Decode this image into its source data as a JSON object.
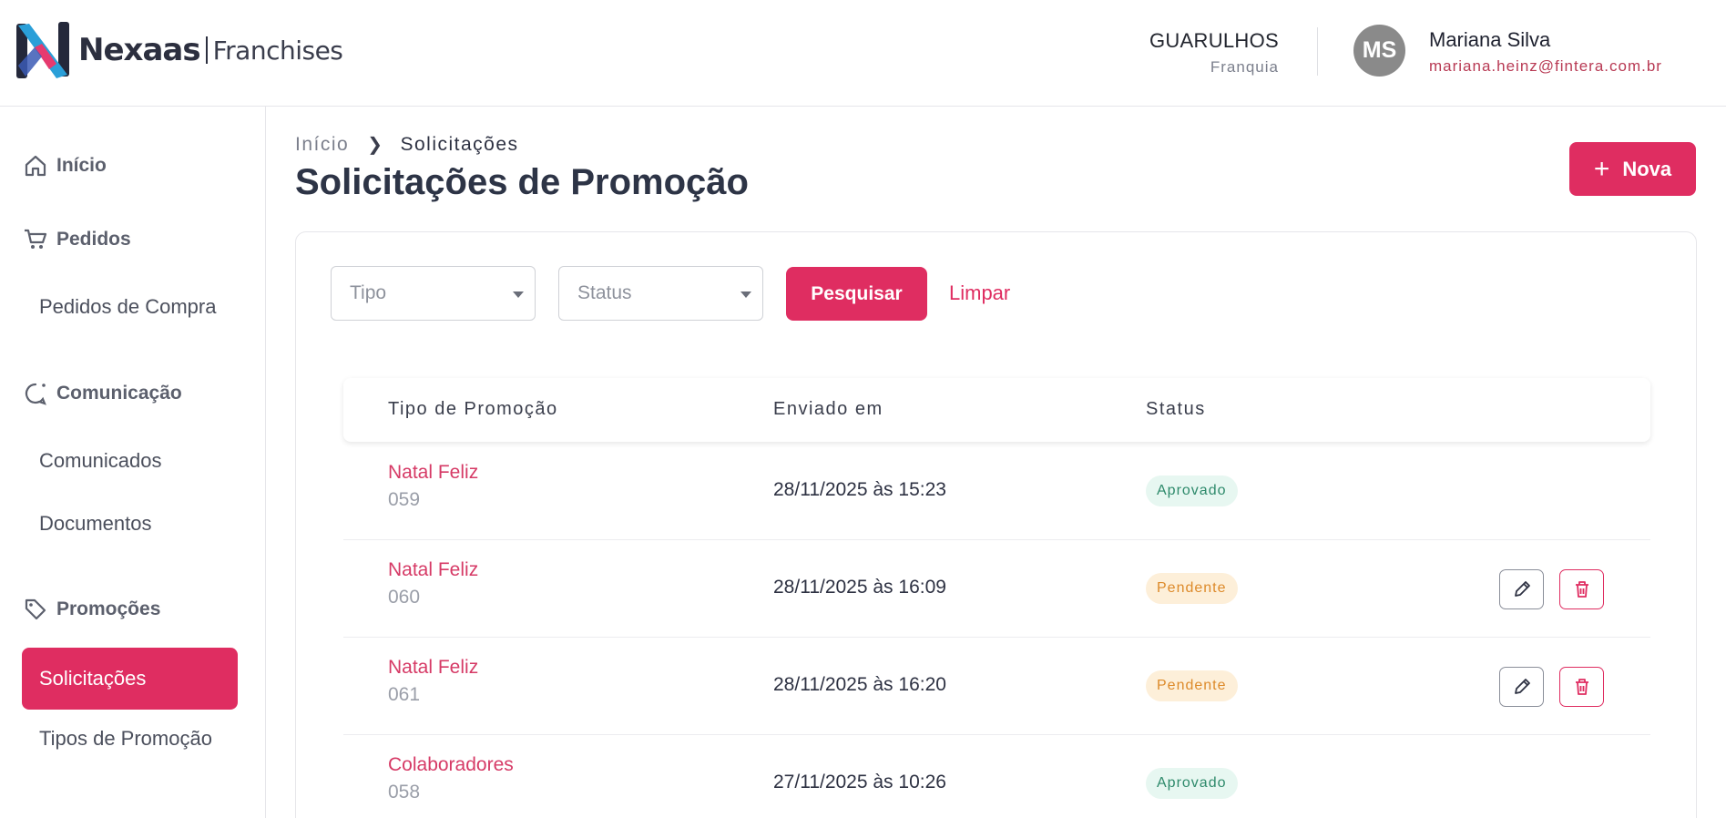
{
  "header": {
    "brand": "Nexaas",
    "brand_sub": "Franchises",
    "branch_name": "GUARULHOS",
    "branch_type": "Franquia",
    "avatar_initials": "MS",
    "user_name": "Mariana Silva",
    "user_email": "mariana.heinz@fintera.com.br"
  },
  "sidebar": {
    "home": "Início",
    "orders": "Pedidos",
    "purchase_orders": "Pedidos de Compra",
    "communication": "Comunicação",
    "announcements": "Comunicados",
    "documents": "Documentos",
    "promotions": "Promoções",
    "requests": "Solicitações",
    "promo_types": "Tipos de Promoção"
  },
  "breadcrumb": {
    "home": "Início",
    "current": "Solicitações"
  },
  "page": {
    "title": "Solicitações de Promoção",
    "new_label": "Nova"
  },
  "filters": {
    "type_placeholder": "Tipo",
    "status_placeholder": "Status",
    "search_label": "Pesquisar",
    "clear_label": "Limpar"
  },
  "table": {
    "columns": [
      "Tipo de Promoção",
      "Enviado em",
      "Status"
    ],
    "rows": [
      {
        "type": "Natal Feliz",
        "number": "059",
        "sent": "28/11/2025 às 15:23",
        "status": "Aprovado"
      },
      {
        "type": "Natal Feliz",
        "number": "060",
        "sent": "28/11/2025 às 16:09",
        "status": "Pendente"
      },
      {
        "type": "Natal Feliz",
        "number": "061",
        "sent": "28/11/2025 às 16:20",
        "status": "Pendente"
      },
      {
        "type": "Colaboradores",
        "number": "058",
        "sent": "27/11/2025 às 10:26",
        "status": "Aprovado"
      }
    ]
  },
  "colors": {
    "accent": "#df2d61",
    "approved_bg": "#e7f7f1",
    "approved_text": "#2e8a6b",
    "pending_bg": "#fdefd9",
    "pending_text": "#dd8a2a"
  },
  "icons": {
    "home": "home-icon",
    "orders": "cart-icon",
    "communication": "chat-icon",
    "promotions": "tag-icon",
    "edit": "pencil-icon",
    "delete": "trash-icon"
  }
}
